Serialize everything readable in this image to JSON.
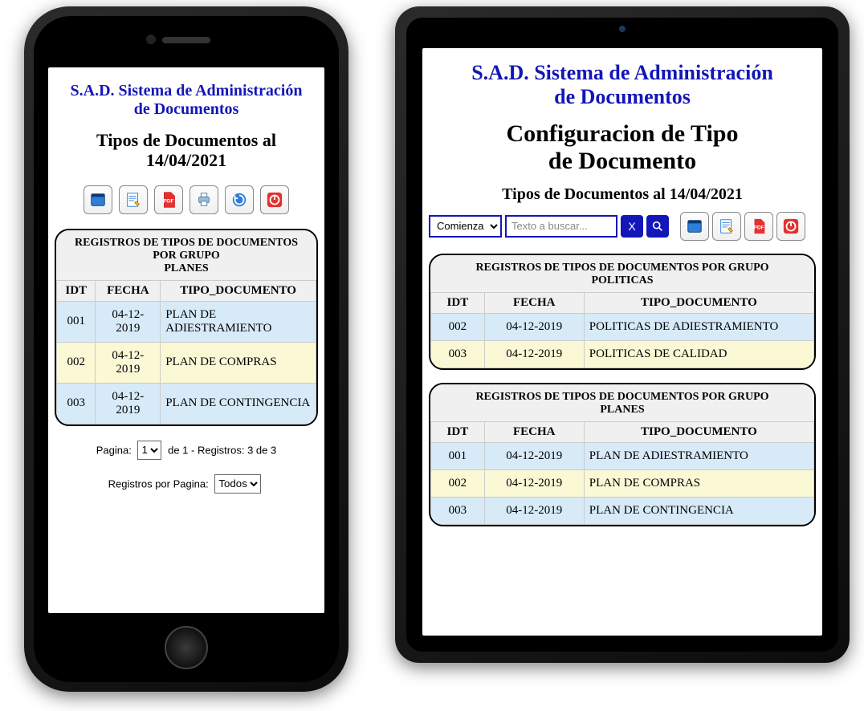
{
  "common": {
    "app_title_line1": "S.A.D. Sistema de Administración",
    "app_title_line2": "de Documentos"
  },
  "phone": {
    "page_title_line1": "Tipos de Documentos al",
    "page_title_line2": "14/04/2021",
    "table": {
      "title_line1": "REGISTROS DE TIPOS DE DOCUMENTOS",
      "title_line2": "POR GRUPO",
      "title_line3": "PLANES",
      "headers": {
        "idt": "IDT",
        "fecha": "FECHA",
        "tipo": "TIPO_DOCUMENTO"
      },
      "rows": [
        {
          "idt": "001",
          "fecha": "04-12-2019",
          "tipo": "PLAN DE ADIESTRAMIENTO"
        },
        {
          "idt": "002",
          "fecha": "04-12-2019",
          "tipo": "PLAN DE COMPRAS"
        },
        {
          "idt": "003",
          "fecha": "04-12-2019",
          "tipo": "PLAN DE CONTINGENCIA"
        }
      ]
    },
    "pagination": {
      "label": "Pagina:",
      "page": "1",
      "suffix": "de 1 - Registros: 3 de 3"
    },
    "per_page": {
      "label": "Registros por Pagina:",
      "value": "Todos"
    }
  },
  "tablet": {
    "page_title_line1": "Configuracion de Tipo",
    "page_title_line2": "de Documento",
    "sub_title": "Tipos de Documentos al 14/04/2021",
    "search_mode": "Comienza",
    "search_placeholder": "Texto a buscar...",
    "clear_label": "X",
    "table1": {
      "title_line1": "REGISTROS DE TIPOS DE DOCUMENTOS POR GRUPO",
      "title_line2": "POLITICAS",
      "headers": {
        "idt": "IDT",
        "fecha": "FECHA",
        "tipo": "TIPO_DOCUMENTO"
      },
      "rows": [
        {
          "idt": "002",
          "fecha": "04-12-2019",
          "tipo": "POLITICAS DE ADIESTRAMIENTO"
        },
        {
          "idt": "003",
          "fecha": "04-12-2019",
          "tipo": "POLITICAS DE CALIDAD"
        }
      ]
    },
    "table2": {
      "title_line1": "REGISTROS DE TIPOS DE DOCUMENTOS POR GRUPO",
      "title_line2": "PLANES",
      "headers": {
        "idt": "IDT",
        "fecha": "FECHA",
        "tipo": "TIPO_DOCUMENTO"
      },
      "rows": [
        {
          "idt": "001",
          "fecha": "04-12-2019",
          "tipo": "PLAN DE ADIESTRAMIENTO"
        },
        {
          "idt": "002",
          "fecha": "04-12-2019",
          "tipo": "PLAN DE COMPRAS"
        },
        {
          "idt": "003",
          "fecha": "04-12-2019",
          "tipo": "PLAN DE CONTINGENCIA"
        }
      ]
    }
  },
  "icons": {
    "window": "window-icon",
    "edit": "edit-icon",
    "pdf": "pdf-icon",
    "print": "print-icon",
    "refresh": "refresh-icon",
    "power": "power-icon",
    "search": "search-icon",
    "clear": "clear-icon"
  }
}
